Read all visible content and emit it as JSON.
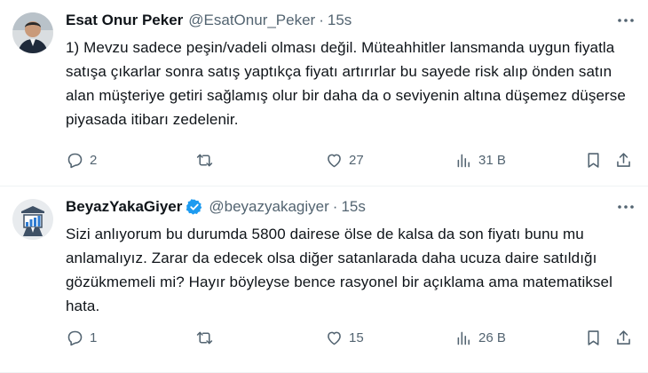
{
  "tweets": [
    {
      "author_name": "Esat Onur Peker",
      "author_handle": "@EsatOnur_Peker",
      "separator": "·",
      "time": "15s",
      "text": "1) Mevzu sadece peşin/vadeli olması değil. Müteahhitler lansmanda uygun fiyatla satışa çıkarlar sonra satış yaptıkça fiyatı artırırlar bu sayede risk alıp önden satın alan müşteriye getiri sağlamış olur bir daha da o seviyenin altına düşemez düşerse piyasada itibarı zedelenir.",
      "replies": "2",
      "retweets": "",
      "likes": "27",
      "views": "31 B",
      "verified": false
    },
    {
      "author_name": "BeyazYakaGiyer",
      "author_handle": "@beyazyakagiyer",
      "separator": "·",
      "time": "15s",
      "text": "Sizi anlıyorum bu durumda 5800 dairese ölse de kalsa da son fiyatı bunu mu anlamalıyız. Zarar da edecek olsa diğer satanlarada daha ucuza daire satıldığı gözükmemeli mi? Hayır böyleyse bence rasyonel bir açıklama ama matematiksel hata.",
      "replies": "1",
      "retweets": "",
      "likes": "15",
      "views": "26 B",
      "verified": true
    }
  ],
  "colors": {
    "text": "#0f1419",
    "muted": "#536471",
    "verified": "#1d9bf0",
    "divider": "#eff3f4"
  },
  "icons": [
    "reply-icon",
    "retweet-icon",
    "like-icon",
    "views-icon",
    "bookmark-icon",
    "share-icon",
    "more-icon",
    "verified-icon"
  ]
}
